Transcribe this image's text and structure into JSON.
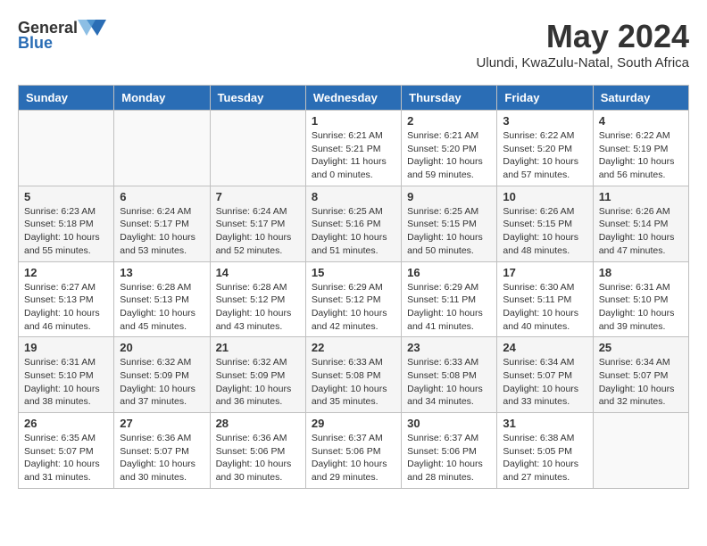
{
  "header": {
    "logo_general": "General",
    "logo_blue": "Blue",
    "month_title": "May 2024",
    "subtitle": "Ulundi, KwaZulu-Natal, South Africa"
  },
  "days_of_week": [
    "Sunday",
    "Monday",
    "Tuesday",
    "Wednesday",
    "Thursday",
    "Friday",
    "Saturday"
  ],
  "weeks": [
    [
      {
        "day": "",
        "info": ""
      },
      {
        "day": "",
        "info": ""
      },
      {
        "day": "",
        "info": ""
      },
      {
        "day": "1",
        "info": "Sunrise: 6:21 AM\nSunset: 5:21 PM\nDaylight: 11 hours\nand 0 minutes."
      },
      {
        "day": "2",
        "info": "Sunrise: 6:21 AM\nSunset: 5:20 PM\nDaylight: 10 hours\nand 59 minutes."
      },
      {
        "day": "3",
        "info": "Sunrise: 6:22 AM\nSunset: 5:20 PM\nDaylight: 10 hours\nand 57 minutes."
      },
      {
        "day": "4",
        "info": "Sunrise: 6:22 AM\nSunset: 5:19 PM\nDaylight: 10 hours\nand 56 minutes."
      }
    ],
    [
      {
        "day": "5",
        "info": "Sunrise: 6:23 AM\nSunset: 5:18 PM\nDaylight: 10 hours\nand 55 minutes."
      },
      {
        "day": "6",
        "info": "Sunrise: 6:24 AM\nSunset: 5:17 PM\nDaylight: 10 hours\nand 53 minutes."
      },
      {
        "day": "7",
        "info": "Sunrise: 6:24 AM\nSunset: 5:17 PM\nDaylight: 10 hours\nand 52 minutes."
      },
      {
        "day": "8",
        "info": "Sunrise: 6:25 AM\nSunset: 5:16 PM\nDaylight: 10 hours\nand 51 minutes."
      },
      {
        "day": "9",
        "info": "Sunrise: 6:25 AM\nSunset: 5:15 PM\nDaylight: 10 hours\nand 50 minutes."
      },
      {
        "day": "10",
        "info": "Sunrise: 6:26 AM\nSunset: 5:15 PM\nDaylight: 10 hours\nand 48 minutes."
      },
      {
        "day": "11",
        "info": "Sunrise: 6:26 AM\nSunset: 5:14 PM\nDaylight: 10 hours\nand 47 minutes."
      }
    ],
    [
      {
        "day": "12",
        "info": "Sunrise: 6:27 AM\nSunset: 5:13 PM\nDaylight: 10 hours\nand 46 minutes."
      },
      {
        "day": "13",
        "info": "Sunrise: 6:28 AM\nSunset: 5:13 PM\nDaylight: 10 hours\nand 45 minutes."
      },
      {
        "day": "14",
        "info": "Sunrise: 6:28 AM\nSunset: 5:12 PM\nDaylight: 10 hours\nand 43 minutes."
      },
      {
        "day": "15",
        "info": "Sunrise: 6:29 AM\nSunset: 5:12 PM\nDaylight: 10 hours\nand 42 minutes."
      },
      {
        "day": "16",
        "info": "Sunrise: 6:29 AM\nSunset: 5:11 PM\nDaylight: 10 hours\nand 41 minutes."
      },
      {
        "day": "17",
        "info": "Sunrise: 6:30 AM\nSunset: 5:11 PM\nDaylight: 10 hours\nand 40 minutes."
      },
      {
        "day": "18",
        "info": "Sunrise: 6:31 AM\nSunset: 5:10 PM\nDaylight: 10 hours\nand 39 minutes."
      }
    ],
    [
      {
        "day": "19",
        "info": "Sunrise: 6:31 AM\nSunset: 5:10 PM\nDaylight: 10 hours\nand 38 minutes."
      },
      {
        "day": "20",
        "info": "Sunrise: 6:32 AM\nSunset: 5:09 PM\nDaylight: 10 hours\nand 37 minutes."
      },
      {
        "day": "21",
        "info": "Sunrise: 6:32 AM\nSunset: 5:09 PM\nDaylight: 10 hours\nand 36 minutes."
      },
      {
        "day": "22",
        "info": "Sunrise: 6:33 AM\nSunset: 5:08 PM\nDaylight: 10 hours\nand 35 minutes."
      },
      {
        "day": "23",
        "info": "Sunrise: 6:33 AM\nSunset: 5:08 PM\nDaylight: 10 hours\nand 34 minutes."
      },
      {
        "day": "24",
        "info": "Sunrise: 6:34 AM\nSunset: 5:07 PM\nDaylight: 10 hours\nand 33 minutes."
      },
      {
        "day": "25",
        "info": "Sunrise: 6:34 AM\nSunset: 5:07 PM\nDaylight: 10 hours\nand 32 minutes."
      }
    ],
    [
      {
        "day": "26",
        "info": "Sunrise: 6:35 AM\nSunset: 5:07 PM\nDaylight: 10 hours\nand 31 minutes."
      },
      {
        "day": "27",
        "info": "Sunrise: 6:36 AM\nSunset: 5:07 PM\nDaylight: 10 hours\nand 30 minutes."
      },
      {
        "day": "28",
        "info": "Sunrise: 6:36 AM\nSunset: 5:06 PM\nDaylight: 10 hours\nand 30 minutes."
      },
      {
        "day": "29",
        "info": "Sunrise: 6:37 AM\nSunset: 5:06 PM\nDaylight: 10 hours\nand 29 minutes."
      },
      {
        "day": "30",
        "info": "Sunrise: 6:37 AM\nSunset: 5:06 PM\nDaylight: 10 hours\nand 28 minutes."
      },
      {
        "day": "31",
        "info": "Sunrise: 6:38 AM\nSunset: 5:05 PM\nDaylight: 10 hours\nand 27 minutes."
      },
      {
        "day": "",
        "info": ""
      }
    ]
  ]
}
